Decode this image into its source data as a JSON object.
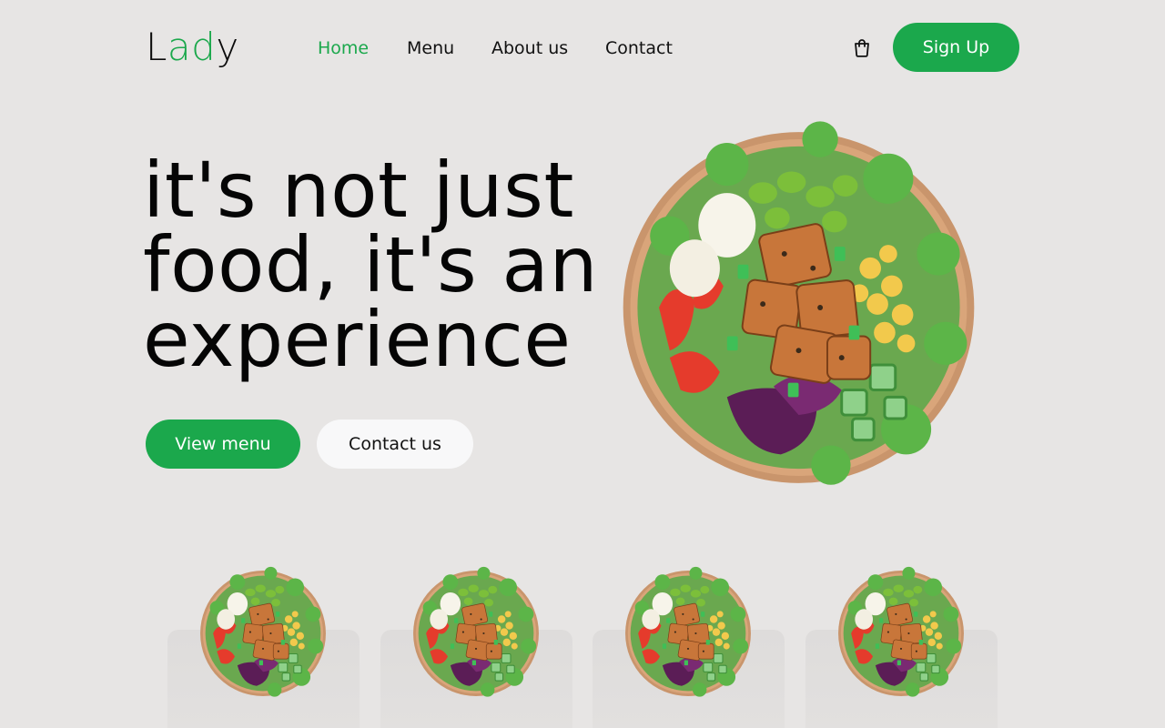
{
  "header": {
    "logo": {
      "part1": "L",
      "part2": "ad",
      "part3": "y"
    },
    "nav": [
      {
        "label": "Home",
        "active": true
      },
      {
        "label": "Menu",
        "active": false
      },
      {
        "label": "About us",
        "active": false
      },
      {
        "label": "Contact",
        "active": false
      }
    ],
    "cart_icon": "shopping-bag-icon",
    "signup_label": "Sign Up"
  },
  "hero": {
    "title_lines": [
      "it's not just",
      "food, it's an",
      "experience"
    ],
    "primary_button": "View menu",
    "secondary_button": "Contact us",
    "image": "salad-bowl"
  },
  "cards": [
    {
      "image": "salad-bowl"
    },
    {
      "image": "salad-bowl"
    },
    {
      "image": "salad-bowl"
    },
    {
      "image": "salad-bowl"
    }
  ],
  "colors": {
    "accent": "#1ba84c",
    "background": "#e7e5e4",
    "secondary_button": "#f8f8f9",
    "text": "#0b0b0b"
  }
}
